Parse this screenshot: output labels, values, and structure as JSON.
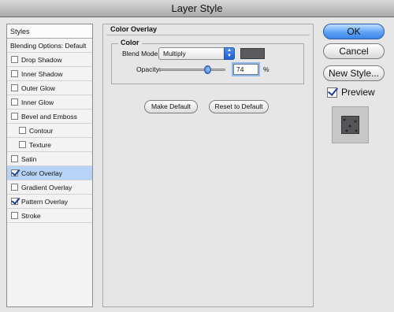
{
  "window": {
    "title": "Layer Style"
  },
  "styles_list": {
    "header": "Styles",
    "items": [
      {
        "label": "Blending Options: Default",
        "type": "plain",
        "checked": false,
        "selected": false
      },
      {
        "label": "Drop Shadow",
        "type": "check",
        "checked": false,
        "selected": false
      },
      {
        "label": "Inner Shadow",
        "type": "check",
        "checked": false,
        "selected": false
      },
      {
        "label": "Outer Glow",
        "type": "check",
        "checked": false,
        "selected": false
      },
      {
        "label": "Inner Glow",
        "type": "check",
        "checked": false,
        "selected": false
      },
      {
        "label": "Bevel and Emboss",
        "type": "check",
        "checked": false,
        "selected": false
      },
      {
        "label": "Contour",
        "type": "indent",
        "checked": false,
        "selected": false
      },
      {
        "label": "Texture",
        "type": "indent",
        "checked": false,
        "selected": false
      },
      {
        "label": "Satin",
        "type": "check",
        "checked": false,
        "selected": false
      },
      {
        "label": "Color Overlay",
        "type": "check",
        "checked": true,
        "selected": true
      },
      {
        "label": "Gradient Overlay",
        "type": "check",
        "checked": false,
        "selected": false
      },
      {
        "label": "Pattern Overlay",
        "type": "check",
        "checked": true,
        "selected": false
      },
      {
        "label": "Stroke",
        "type": "check",
        "checked": false,
        "selected": false
      }
    ]
  },
  "panel": {
    "title": "Color Overlay",
    "group_title": "Color",
    "blend_mode_label": "Blend Mode:",
    "blend_mode_value": "Multiply",
    "overlay_color": "#5b5b5f",
    "opacity_label": "Opacity:",
    "opacity_value": "74",
    "opacity_fraction": 0.74,
    "percent_sign": "%",
    "make_default": "Make Default",
    "reset_default": "Reset to Default"
  },
  "buttons": {
    "ok": "OK",
    "cancel": "Cancel",
    "new_style": "New Style..."
  },
  "preview": {
    "label": "Preview",
    "checked": true
  },
  "colors": {
    "selection": "#b7d3f6",
    "default_button": "#5ea2f4"
  }
}
